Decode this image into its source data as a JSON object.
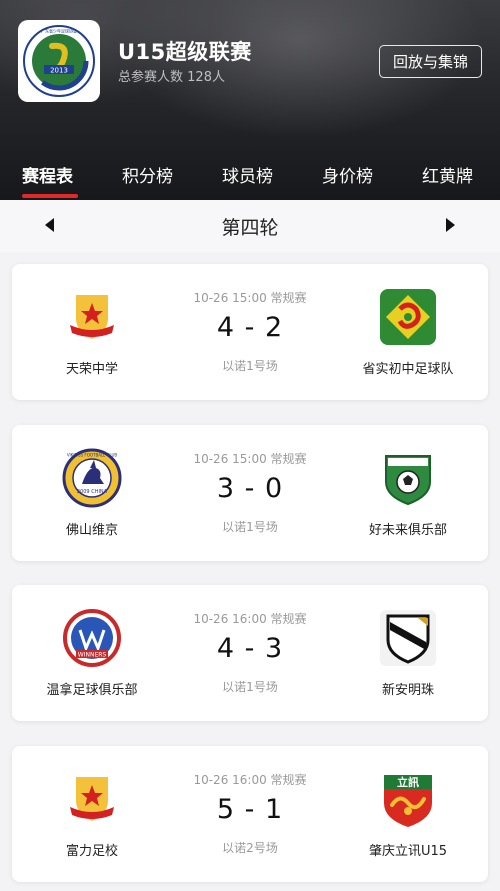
{
  "header": {
    "title": "U15超级联赛",
    "participants_label": "总参赛人数",
    "participants_count": "128人",
    "replay_button": "回放与集锦",
    "logo_text": "广东省少年足球协会",
    "logo_year": "2013"
  },
  "tabs": [
    {
      "label": "赛程表",
      "active": true
    },
    {
      "label": "积分榜",
      "active": false
    },
    {
      "label": "球员榜",
      "active": false
    },
    {
      "label": "身价榜",
      "active": false
    },
    {
      "label": "红黄牌",
      "active": false
    }
  ],
  "round": {
    "title": "第四轮",
    "prev_icon": "triangle-left",
    "next_icon": "triangle-right"
  },
  "matches": [
    {
      "home": {
        "name": "天荣中学",
        "logo": "shield-star-logo"
      },
      "away": {
        "name": "省实初中足球队",
        "logo": "green-emblem-logo"
      },
      "time": "10-26 15:00 常规赛",
      "score": "4 - 2",
      "venue": "以诺1号场"
    },
    {
      "home": {
        "name": "佛山维京",
        "logo": "vikings-crest-logo",
        "logo_text": "VIKINGS FOOTBALL CLUB",
        "logo_year": "2009 CHINA"
      },
      "away": {
        "name": "好未来俱乐部",
        "logo": "shield-ball-logo"
      },
      "time": "10-26 15:00 常规赛",
      "score": "3 - 0",
      "venue": "以诺1号场"
    },
    {
      "home": {
        "name": "温拿足球俱乐部",
        "logo": "winners-crest-logo",
        "logo_text": "WINNERS"
      },
      "away": {
        "name": "新安明珠",
        "logo": "black-white-shield-logo"
      },
      "time": "10-26 16:00 常规赛",
      "score": "4 - 3",
      "venue": "以诺1号场"
    },
    {
      "home": {
        "name": "富力足校",
        "logo": "shield-star-logo"
      },
      "away": {
        "name": "肇庆立讯U15",
        "logo": "lixun-dragon-logo",
        "logo_text": "立訊"
      },
      "time": "10-26 16:00 常规赛",
      "score": "5 - 1",
      "venue": "以诺2号场"
    }
  ],
  "colors": {
    "accent_red": "#e02a2a",
    "header_dark": "#26272b",
    "card_bg": "#ffffff",
    "page_bg": "#f3f3f5"
  }
}
